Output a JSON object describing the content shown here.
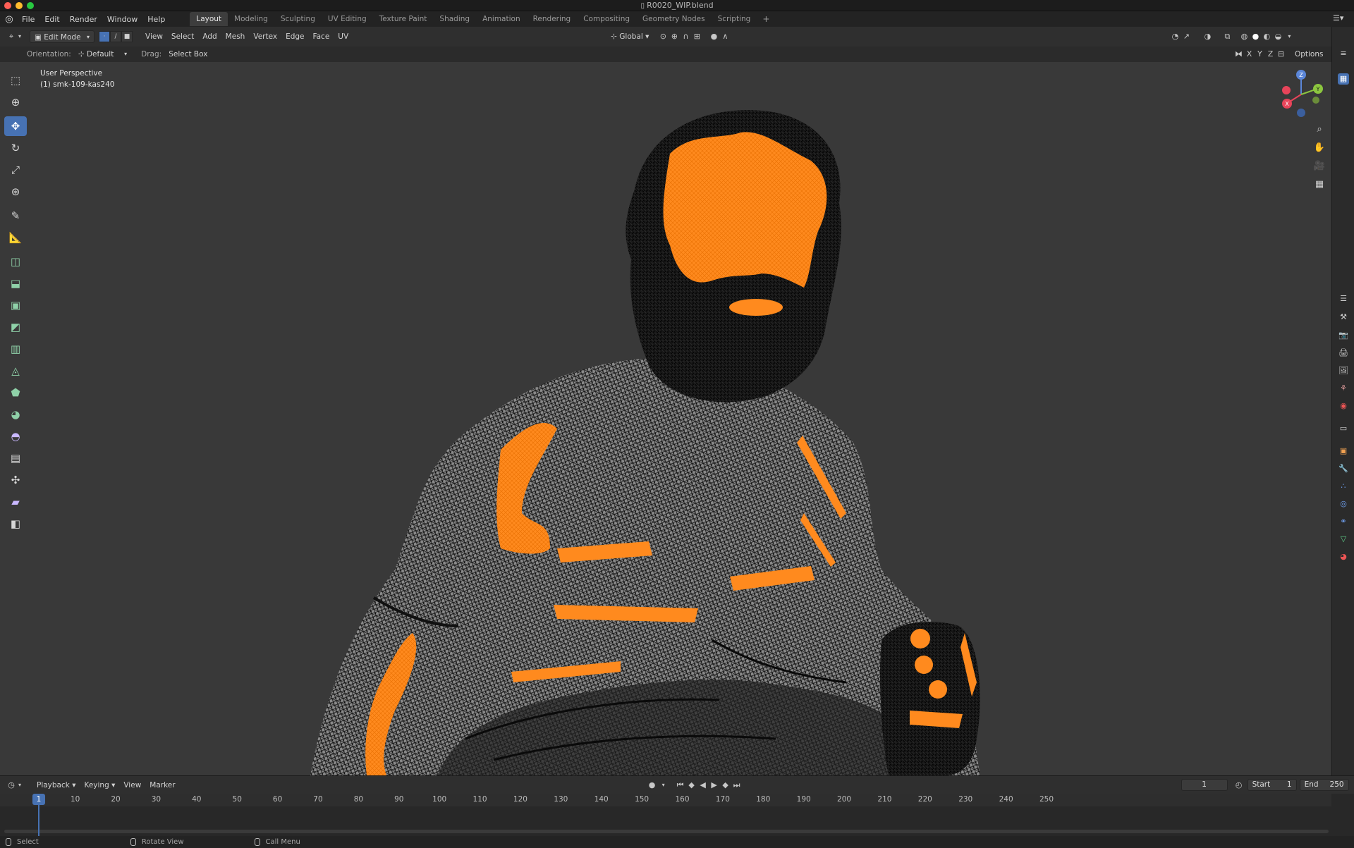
{
  "window": {
    "title": "R0020_WIP.blend"
  },
  "menu": {
    "items": [
      "File",
      "Edit",
      "Render",
      "Window",
      "Help"
    ]
  },
  "workspaces": {
    "tabs": [
      "Layout",
      "Modeling",
      "Sculpting",
      "UV Editing",
      "Texture Paint",
      "Shading",
      "Animation",
      "Rendering",
      "Compositing",
      "Geometry Nodes",
      "Scripting"
    ],
    "active": "Layout",
    "add": "+"
  },
  "header": {
    "mode": "Edit Mode",
    "menus": [
      "View",
      "Select",
      "Add",
      "Mesh",
      "Vertex",
      "Edge",
      "Face",
      "UV"
    ],
    "transform_orientation": "Global"
  },
  "tool_settings": {
    "orientation_label": "Orientation:",
    "orientation_value": "Default",
    "drag_label": "Drag:",
    "drag_value": "Select Box",
    "axes": [
      "X",
      "Y",
      "Z"
    ],
    "options": "Options"
  },
  "viewport": {
    "perspective": "User Perspective",
    "object": "(1) smk-109-kas240",
    "colors": {
      "background": "#393939",
      "selection": "#ff8a1e",
      "mesh": "#0d0d0d",
      "mesh_light": "#9a9a9a"
    }
  },
  "gizmo": {
    "z": "Z",
    "x": "X",
    "y": "Y"
  },
  "timeline": {
    "menus": [
      "Playback",
      "Keying",
      "View",
      "Marker"
    ],
    "current_frame": "1",
    "start_label": "Start",
    "start": "1",
    "end_label": "End",
    "end": "250",
    "ruler": [
      "1",
      "10",
      "20",
      "30",
      "40",
      "50",
      "60",
      "70",
      "80",
      "90",
      "100",
      "110",
      "120",
      "130",
      "140",
      "150",
      "160",
      "170",
      "180",
      "190",
      "200",
      "210",
      "220",
      "230",
      "240",
      "250"
    ]
  },
  "status": {
    "select": "Select",
    "rotate": "Rotate View",
    "menu": "Call Menu"
  },
  "accent": "#4772b3"
}
